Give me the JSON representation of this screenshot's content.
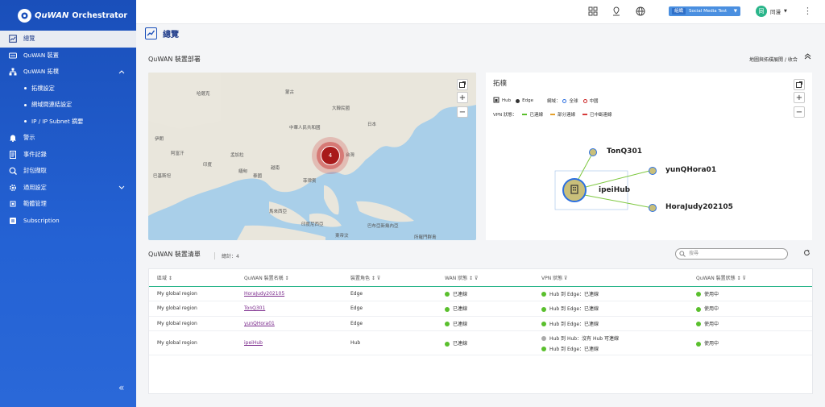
{
  "app": {
    "brand": "QuWAN",
    "product": "Orchestrator"
  },
  "sidebar": {
    "items": [
      {
        "label": "總覽"
      },
      {
        "label": "QuWAN 裝置"
      },
      {
        "label": "QuWAN 拓樸"
      },
      {
        "label": "拓樸設定"
      },
      {
        "label": "網域間連結設定"
      },
      {
        "label": "IP / IP Subnet 摘要"
      },
      {
        "label": "警示"
      },
      {
        "label": "事件記錄"
      },
      {
        "label": "封包擷取"
      },
      {
        "label": "通用設定"
      },
      {
        "label": "範體管理"
      },
      {
        "label": "Subscription"
      }
    ]
  },
  "topbar": {
    "org_tag": "組織",
    "org_name": "Social Media Test",
    "user_initial": "同",
    "user_name": "同漫"
  },
  "page": {
    "title": "總覽"
  },
  "deploy": {
    "title": "QuWAN 裝置部署",
    "toggle": "地圖與拓樸展開 / 收合",
    "cluster_count": "4",
    "labels": [
      "中華人民共和國",
      "蒙古",
      "日本",
      "大韓民國",
      "印度",
      "泰國",
      "越南",
      "菲律賓",
      "台灣",
      "哈薩克",
      "伊朗",
      "阿富汗",
      "巴基斯坦",
      "孟加拉",
      "緬甸",
      "馬來西亞",
      "印度尼西亞",
      "巴布亞新幾內亞",
      "所羅門群島",
      "東帝汶"
    ]
  },
  "topology": {
    "title": "拓樸",
    "hub_label": "Hub",
    "edge_label": "Edge",
    "domain_label": "網域：",
    "global_label": "全球",
    "china_label": "中國",
    "vpn_label": "VPN 狀態：",
    "connected": "已連線",
    "partial": "部分連線",
    "disconnected": "已中斷連線",
    "nodes": {
      "hub": "ipeiHub",
      "n1": "TonQ301",
      "n2": "yunQHora01",
      "n3": "HoraJudy202105"
    }
  },
  "list": {
    "title": "QuWAN 裝置清單",
    "total": "總計：4",
    "search_placeholder": "搜尋",
    "headers": [
      "區域",
      "QuWAN 裝置名稱",
      "裝置角色",
      "WAN 狀態",
      "VPN 狀態",
      "QuWAN 裝置狀態"
    ],
    "rows": [
      {
        "region": "My global region",
        "name": "HoraJudy202105",
        "role": "Edge",
        "wan": "已連線",
        "vpn1": "Hub 到 Edge：已連線",
        "vpn2": "",
        "status": "使用中"
      },
      {
        "region": "My global region",
        "name": "TonQ301",
        "role": "Edge",
        "wan": "已連線",
        "vpn1": "Hub 到 Edge：已連線",
        "vpn2": "",
        "status": "使用中"
      },
      {
        "region": "My global region",
        "name": "yunQHora01",
        "role": "Edge",
        "wan": "已連線",
        "vpn1": "Hub 到 Edge：已連線",
        "vpn2": "",
        "status": "使用中"
      },
      {
        "region": "My global region",
        "name": "ipeiHub",
        "role": "Hub",
        "wan": "已連線",
        "vpn1": "Hub 到 Hub：沒有 Hub 可連線",
        "vpn2": "Hub 到 Edge：已連線",
        "status": "使用中"
      }
    ]
  },
  "colors": {
    "sidebar": "#1a4fba",
    "accent": "#2ab58a",
    "connected": "#5abf2d",
    "cluster": "#a81a1a"
  }
}
